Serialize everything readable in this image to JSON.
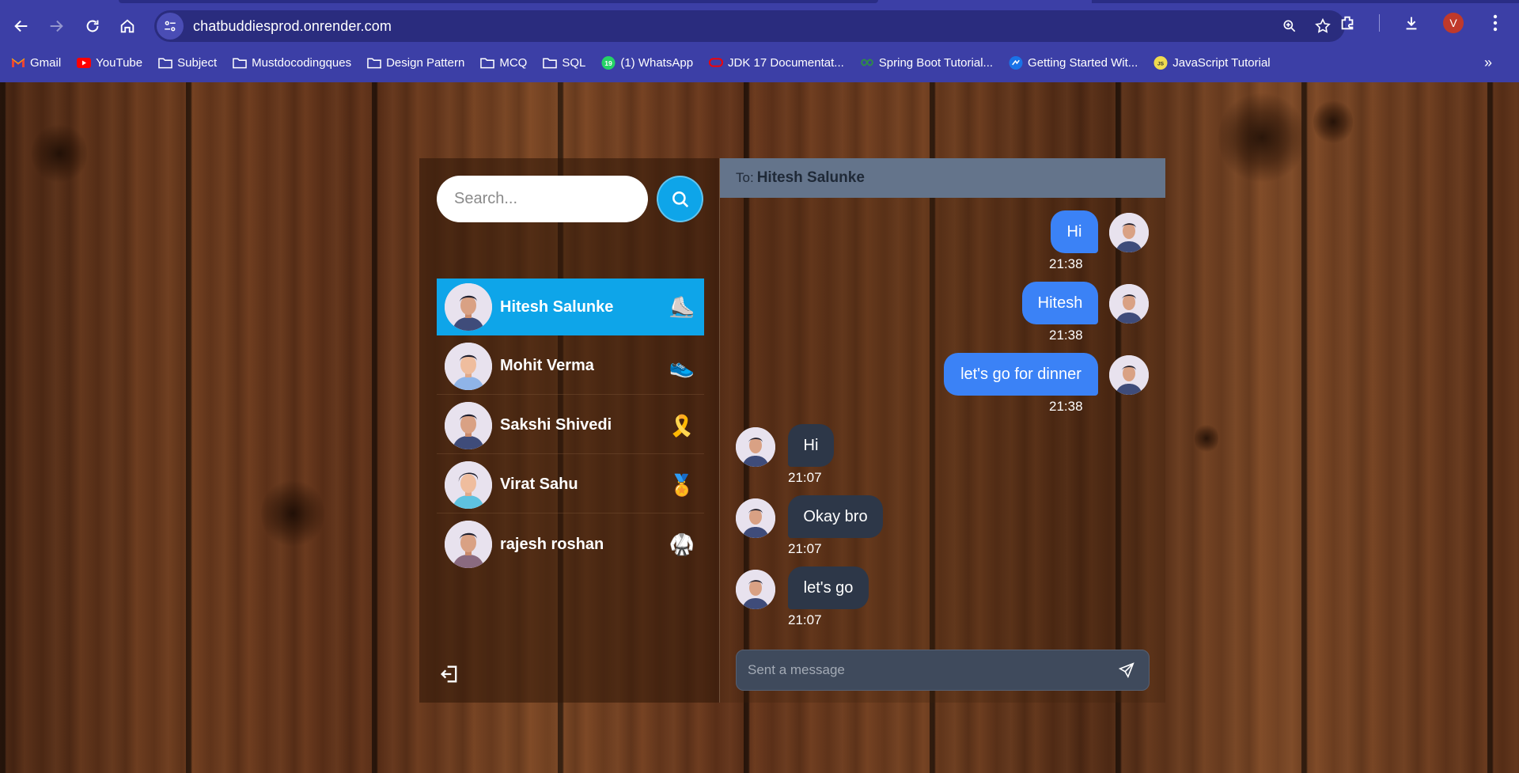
{
  "browser": {
    "url": "chatbuddiesprod.onrender.com",
    "profile_initial": "V",
    "bookmarks": [
      {
        "label": "Gmail",
        "icon": "gmail-icon"
      },
      {
        "label": "YouTube",
        "icon": "youtube-icon"
      },
      {
        "label": "Subject",
        "icon": "folder-icon"
      },
      {
        "label": "Mustdocodingques",
        "icon": "folder-icon"
      },
      {
        "label": "Design Pattern",
        "icon": "folder-icon"
      },
      {
        "label": "MCQ",
        "icon": "folder-icon"
      },
      {
        "label": "SQL",
        "icon": "folder-icon"
      },
      {
        "label": "(1) WhatsApp",
        "icon": "whatsapp-icon",
        "badge": "19"
      },
      {
        "label": "JDK 17 Documentat...",
        "icon": "oracle-icon"
      },
      {
        "label": "Spring Boot Tutorial...",
        "icon": "spring-icon"
      },
      {
        "label": "Getting Started Wit...",
        "icon": "swagger-icon"
      },
      {
        "label": "JavaScript Tutorial",
        "icon": "javascript-icon",
        "badge": "JS"
      }
    ]
  },
  "sidebar": {
    "search_placeholder": "Search...",
    "contacts": [
      {
        "name": "Hitesh Salunke",
        "emoji": "⛸️",
        "active": true
      },
      {
        "name": "Mohit Verma",
        "emoji": "👟",
        "active": false
      },
      {
        "name": "Sakshi Shivedi",
        "emoji": "🎗️",
        "active": false
      },
      {
        "name": "Virat Sahu",
        "emoji": "🏅",
        "active": false
      },
      {
        "name": "rajesh roshan",
        "emoji": "🥋",
        "active": false
      }
    ]
  },
  "chat": {
    "to_label": "To:",
    "to_name": "Hitesh Salunke",
    "messages": [
      {
        "text": "Hi",
        "time": "21:38",
        "direction": "out"
      },
      {
        "text": "Hitesh",
        "time": "21:38",
        "direction": "out"
      },
      {
        "text": "let's go for dinner",
        "time": "21:38",
        "direction": "out"
      },
      {
        "text": "Hi",
        "time": "21:07",
        "direction": "in"
      },
      {
        "text": "Okay bro",
        "time": "21:07",
        "direction": "in"
      },
      {
        "text": "let's go",
        "time": "21:07",
        "direction": "in"
      }
    ],
    "composer_placeholder": "Sent a message"
  },
  "colors": {
    "accent": "#0ea5e9",
    "outgoing_bubble": "#3b82f6",
    "incoming_bubble": "#2d3748",
    "header": "#64748b",
    "browser_frame": "#3c3fa6"
  }
}
